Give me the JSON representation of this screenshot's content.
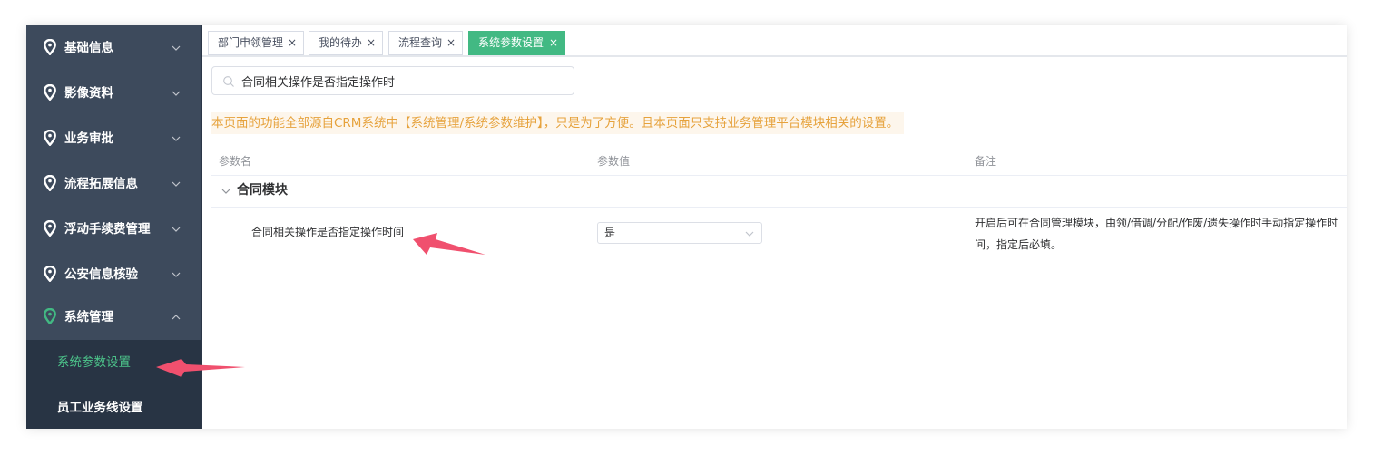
{
  "sidebar": {
    "items": [
      {
        "label": "基础信息",
        "expanded": false
      },
      {
        "label": "影像资料",
        "expanded": false
      },
      {
        "label": "业务审批",
        "expanded": false
      },
      {
        "label": "流程拓展信息",
        "expanded": false
      },
      {
        "label": "浮动手续费管理",
        "expanded": false
      },
      {
        "label": "公安信息核验",
        "expanded": false
      },
      {
        "label": "系统管理",
        "expanded": true
      }
    ],
    "submenu": [
      {
        "label": "系统参数设置",
        "active": true
      },
      {
        "label": "员工业务线设置",
        "active": false
      }
    ]
  },
  "tabs": [
    {
      "label": "部门申领管理",
      "close": "×",
      "active": false
    },
    {
      "label": "我的待办",
      "close": "×",
      "active": false
    },
    {
      "label": "流程查询",
      "close": "×",
      "active": false
    },
    {
      "label": "系统参数设置",
      "close": "×",
      "active": true
    }
  ],
  "search": {
    "value": "合同相关操作是否指定操作时",
    "icon": "search-icon"
  },
  "notice": "本页面的功能全部源自CRM系统中【系统管理/系统参数维护】，只是为了方便。且本页面只支持业务管理平台模块相关的设置。",
  "table": {
    "headers": [
      "参数名",
      "参数值",
      "备注"
    ],
    "group": {
      "label": "合同模块",
      "expanded": true
    },
    "rows": [
      {
        "name": "合同相关操作是否指定操作时间",
        "value": "是",
        "remark_line1": "开启后可在合同管理模块，由领/借调/分配/作废/遗失操作时手动指定操作时",
        "remark_line2": "间，指定后必填。"
      }
    ]
  },
  "colors": {
    "sidebar_bg": "#3d4a5c",
    "submenu_bg": "#283444",
    "accent_green": "#42b983",
    "notice_text": "#e6a23c",
    "notice_bg": "#fdf6ec",
    "annotation_arrow": "#f0506e"
  }
}
